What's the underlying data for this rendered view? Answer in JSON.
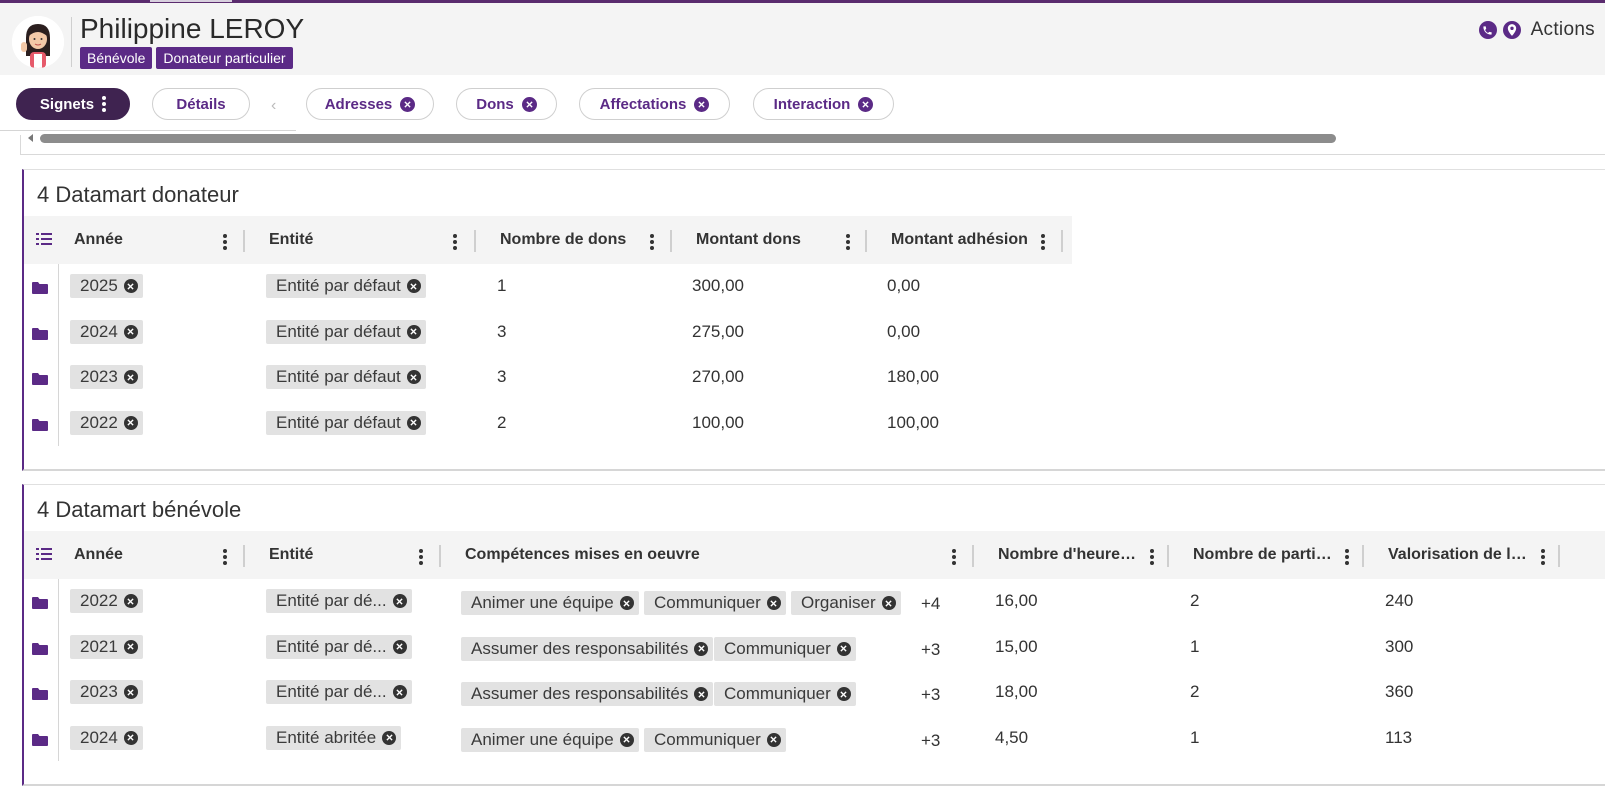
{
  "header": {
    "name": "Philippine LEROY",
    "tags": [
      "Bénévole",
      "Donateur particulier"
    ],
    "actions_label": "Actions",
    "icons": [
      "phone-icon",
      "map-pin-icon"
    ]
  },
  "tabs": [
    {
      "label": "Signets",
      "active": true
    },
    {
      "label": "Détails",
      "active": false
    },
    {
      "label": "Adresses",
      "closable": true
    },
    {
      "label": "Dons",
      "closable": true
    },
    {
      "label": "Affectations",
      "closable": true
    },
    {
      "label": "Interaction",
      "closable": true
    }
  ],
  "colors": {
    "accent": "#5b2a86",
    "dark_pill": "#3f2350"
  },
  "donateur": {
    "title": "4 Datamart donateur",
    "columns": [
      "Année",
      "Entité",
      "Nombre de dons",
      "Montant dons",
      "Montant adhésion"
    ],
    "rows": [
      {
        "annee": "2025",
        "entite": "Entité par défaut",
        "nb_dons": "1",
        "montant_dons": "300,00",
        "montant_adhesion": "0,00"
      },
      {
        "annee": "2024",
        "entite": "Entité par défaut",
        "nb_dons": "3",
        "montant_dons": "275,00",
        "montant_adhesion": "0,00"
      },
      {
        "annee": "2023",
        "entite": "Entité par défaut",
        "nb_dons": "3",
        "montant_dons": "270,00",
        "montant_adhesion": "180,00"
      },
      {
        "annee": "2022",
        "entite": "Entité par défaut",
        "nb_dons": "2",
        "montant_dons": "100,00",
        "montant_adhesion": "100,00"
      }
    ]
  },
  "benevole": {
    "title": "4 Datamart bénévole",
    "columns": [
      "Année",
      "Entité",
      "Compétences mises en oeuvre",
      "Nombre d'heures ...",
      "Nombre de partici...",
      "Valorisation de la ..."
    ],
    "rows": [
      {
        "annee": "2022",
        "entite": "Entité par dé...",
        "competences": [
          "Animer une équipe",
          "Communiquer",
          "Organiser"
        ],
        "more": "+4",
        "heures": "16,00",
        "participations": "2",
        "valorisation": "240"
      },
      {
        "annee": "2021",
        "entite": "Entité par dé...",
        "competences": [
          "Assumer des responsabilités",
          "Communiquer"
        ],
        "more": "+3",
        "heures": "15,00",
        "participations": "1",
        "valorisation": "300"
      },
      {
        "annee": "2023",
        "entite": "Entité par dé...",
        "competences": [
          "Assumer des responsabilités",
          "Communiquer"
        ],
        "more": "+3",
        "heures": "18,00",
        "participations": "2",
        "valorisation": "360"
      },
      {
        "annee": "2024",
        "entite": "Entité abritée",
        "competences": [
          "Animer une équipe",
          "Communiquer"
        ],
        "more": "+3",
        "heures": "4,50",
        "participations": "1",
        "valorisation": "113"
      }
    ]
  }
}
